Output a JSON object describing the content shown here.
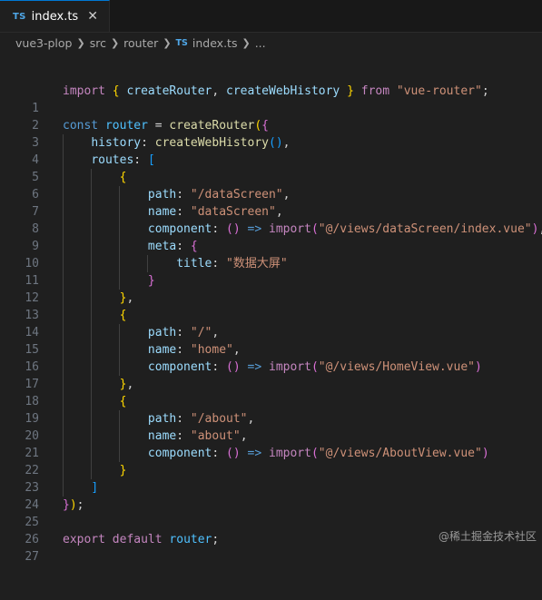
{
  "tab": {
    "badge": "TS",
    "label": "index.ts",
    "close": "✕"
  },
  "breadcrumb": {
    "items": [
      "vue3-plop",
      "src",
      "router"
    ],
    "file_badge": "TS",
    "file": "index.ts",
    "more": "..."
  },
  "lines": [
    {
      "n": "1"
    },
    {
      "n": "2"
    },
    {
      "n": "3"
    },
    {
      "n": "4"
    },
    {
      "n": "5"
    },
    {
      "n": "6"
    },
    {
      "n": "7"
    },
    {
      "n": "8"
    },
    {
      "n": "9"
    },
    {
      "n": "10"
    },
    {
      "n": "11"
    },
    {
      "n": "12"
    },
    {
      "n": "13"
    },
    {
      "n": "14"
    },
    {
      "n": "15"
    },
    {
      "n": "16"
    },
    {
      "n": "17"
    },
    {
      "n": "18"
    },
    {
      "n": "19"
    },
    {
      "n": "20"
    },
    {
      "n": "21"
    },
    {
      "n": "22"
    },
    {
      "n": "23"
    },
    {
      "n": "24"
    },
    {
      "n": "25"
    },
    {
      "n": "26"
    },
    {
      "n": "27"
    }
  ],
  "code": {
    "import_kw": "import",
    "named_imports": [
      "createRouter",
      "createWebHistory"
    ],
    "from_kw": "from",
    "module": "\"vue-router\"",
    "const_kw": "const",
    "router_var": "router",
    "history_key": "history",
    "routes_key": "routes",
    "path_key": "path",
    "name_key": "name",
    "component_key": "component",
    "meta_key": "meta",
    "title_key": "title",
    "routes": [
      {
        "path": "\"/dataScreen\"",
        "name": "\"dataScreen\"",
        "import": "\"@/views/dataScreen/index.vue\"",
        "title": "\"数据大屏\""
      },
      {
        "path": "\"/\"",
        "name": "\"home\"",
        "import": "\"@/views/HomeView.vue\""
      },
      {
        "path": "\"/about\"",
        "name": "\"about\"",
        "import": "\"@/views/AboutView.vue\""
      }
    ],
    "export_kw": "export",
    "default_kw": "default"
  },
  "watermark": "@稀土掘金技术社区",
  "colors": {
    "background": "#1f1f1f",
    "keyword_control": "#c586c0",
    "keyword": "#569cd6",
    "variable": "#9cdcfe",
    "function": "#dcdcaa",
    "string": "#ce9178",
    "bracket_1": "#ffd700",
    "bracket_2": "#da70d6",
    "bracket_3": "#179fff",
    "ts_badge": "#4fa7e8"
  }
}
